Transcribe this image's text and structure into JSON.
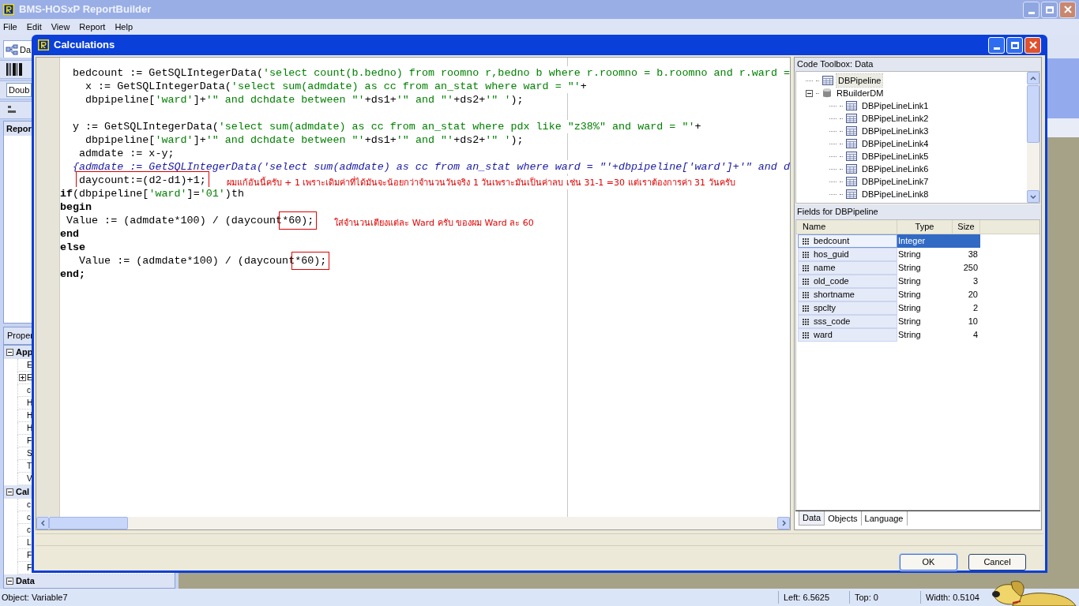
{
  "app": {
    "title": "BMS-HOSxP ReportBuilder",
    "menu": [
      "File",
      "Edit",
      "View",
      "Report",
      "Help"
    ]
  },
  "left_panel": {
    "tab": "Da",
    "toolbar_label": "Doub",
    "header": "Repor",
    "properties_tab": "Proper",
    "groups": [
      {
        "label": "App",
        "expanded": true,
        "rows": [
          {
            "label": "E",
            "kind": "plain"
          },
          {
            "label": "E",
            "kind": "expandable"
          },
          {
            "label": "c",
            "kind": "plain"
          },
          {
            "label": "H",
            "kind": "plain"
          },
          {
            "label": "H",
            "kind": "plain"
          },
          {
            "label": "H",
            "kind": "plain"
          },
          {
            "label": "F",
            "kind": "plain"
          },
          {
            "label": "S",
            "kind": "plain"
          },
          {
            "label": "T",
            "kind": "plain"
          },
          {
            "label": "V",
            "kind": "plain"
          }
        ]
      },
      {
        "label": "Cal",
        "expanded": true,
        "rows": [
          {
            "label": "c",
            "kind": "plain"
          },
          {
            "label": "c",
            "kind": "plain"
          },
          {
            "label": "c",
            "kind": "plain"
          },
          {
            "label": "L",
            "kind": "plain"
          },
          {
            "label": "F",
            "kind": "plain"
          },
          {
            "label": "F",
            "kind": "plain"
          }
        ]
      },
      {
        "label": "Data",
        "expanded": true
      }
    ]
  },
  "dialog": {
    "title": "Calculations",
    "code_lines": [
      {
        "kind": "code",
        "segments": [
          {
            "kind": "plain",
            "text": "  bedcount := GetSQLIntegerData("
          },
          {
            "kind": "string",
            "text": "'select count(b.bedno) from roomno r,bedno b where r.roomno = b.roomno and r.ward ="
          }
        ]
      },
      {
        "kind": "code",
        "segments": [
          {
            "kind": "plain",
            "text": "    x := GetSQLIntegerData("
          },
          {
            "kind": "string",
            "text": "'select sum(admdate) as cc from an_stat where ward = \"'"
          },
          {
            "kind": "plain",
            "text": "+"
          }
        ]
      },
      {
        "kind": "code",
        "segments": [
          {
            "kind": "plain",
            "text": "    dbpipeline["
          },
          {
            "kind": "string",
            "text": "'ward'"
          },
          {
            "kind": "plain",
            "text": "]+"
          },
          {
            "kind": "string",
            "text": "'\" and dchdate between \"'"
          },
          {
            "kind": "plain",
            "text": "+ds1+"
          },
          {
            "kind": "string",
            "text": "'\" and \"'"
          },
          {
            "kind": "plain",
            "text": "+ds2+"
          },
          {
            "kind": "string",
            "text": "'\" '"
          },
          {
            "kind": "plain",
            "text": ");"
          }
        ]
      },
      {
        "kind": "blank"
      },
      {
        "kind": "code",
        "segments": [
          {
            "kind": "plain",
            "text": "  y := GetSQLIntegerData("
          },
          {
            "kind": "string",
            "text": "'select sum(admdate) as cc from an_stat where pdx like \"z38%\" and ward = \"'"
          },
          {
            "kind": "plain",
            "text": "+"
          }
        ]
      },
      {
        "kind": "code",
        "segments": [
          {
            "kind": "plain",
            "text": "    dbpipeline["
          },
          {
            "kind": "string",
            "text": "'ward'"
          },
          {
            "kind": "plain",
            "text": "]+"
          },
          {
            "kind": "string",
            "text": "'\" and dchdate between \"'"
          },
          {
            "kind": "plain",
            "text": "+ds1+"
          },
          {
            "kind": "string",
            "text": "'\" and \"'"
          },
          {
            "kind": "plain",
            "text": "+ds2+"
          },
          {
            "kind": "string",
            "text": "'\" '"
          },
          {
            "kind": "plain",
            "text": ");"
          }
        ]
      },
      {
        "kind": "code",
        "segments": [
          {
            "kind": "plain",
            "text": "   admdate := x-y;"
          }
        ]
      },
      {
        "kind": "code",
        "segments": [
          {
            "kind": "comment",
            "text": "  {admdate := GetSQLIntegerData('select sum(admdate) as cc from an_stat where ward = \"'+dbpipeline['ward']+'\" and d"
          }
        ]
      },
      {
        "kind": "code",
        "segments": [
          {
            "kind": "plain",
            "text": "   daycount:=(d2-d1)+1;",
            "boxed": true
          }
        ],
        "note": "ผมแก้อันนี้ครับ + 1 เพราะเดิมค่าที่ได้มันจะน้อยกว่าจำนวนวันจริง 1 วันเพราะมันเป็นค่าลบ เช่น 31-1 =30  แต่เราต้องการค่า 31 วันครับ"
      },
      {
        "kind": "code",
        "segments": [
          {
            "kind": "keyword",
            "text": "if"
          },
          {
            "kind": "plain",
            "text": "(dbpipeline["
          },
          {
            "kind": "string",
            "text": "'ward'"
          },
          {
            "kind": "plain",
            "text": "]="
          },
          {
            "kind": "string",
            "text": "'01'"
          },
          {
            "kind": "plain",
            "text": ")th"
          }
        ]
      },
      {
        "kind": "code",
        "segments": [
          {
            "kind": "keyword",
            "text": "begin"
          }
        ]
      },
      {
        "kind": "code",
        "segments": [
          {
            "kind": "plain",
            "text": " Value := (admdate*100) / (daycount"
          },
          {
            "kind": "plain",
            "text": "*60);",
            "boxed": true
          }
        ],
        "note": "ใส่จำนวนเตียงแต่ละ Ward ครับ ของผม Ward ละ 60"
      },
      {
        "kind": "code",
        "segments": [
          {
            "kind": "keyword",
            "text": "end"
          }
        ]
      },
      {
        "kind": "code",
        "segments": [
          {
            "kind": "keyword",
            "text": "else"
          }
        ]
      },
      {
        "kind": "code",
        "segments": [
          {
            "kind": "plain",
            "text": "   Value := (admdate*100) / (daycount"
          },
          {
            "kind": "plain",
            "text": "*60);",
            "boxed": true
          }
        ]
      },
      {
        "kind": "code",
        "segments": [
          {
            "kind": "keyword",
            "text": "end;"
          }
        ]
      }
    ],
    "toolbox": {
      "title": "Code Toolbox: Data",
      "tree": [
        {
          "label": "DBPipeline",
          "kind": "table",
          "selected": true
        },
        {
          "label": "RBuilderDM",
          "kind": "database",
          "selected": false,
          "expanded": true,
          "children": [
            {
              "label": "DBPipeLineLink1",
              "kind": "table",
              "selected": false
            },
            {
              "label": "DBPipeLineLink2",
              "kind": "table",
              "selected": false
            },
            {
              "label": "DBPipeLineLink3",
              "kind": "table",
              "selected": false
            },
            {
              "label": "DBPipeLineLink4",
              "kind": "table",
              "selected": false
            },
            {
              "label": "DBPipeLineLink5",
              "kind": "table",
              "selected": false
            },
            {
              "label": "DBPipeLineLink6",
              "kind": "table",
              "selected": false
            },
            {
              "label": "DBPipeLineLink7",
              "kind": "table",
              "selected": false
            },
            {
              "label": "DBPipeLineLink8",
              "kind": "table",
              "selected": false
            }
          ]
        }
      ]
    },
    "fields": {
      "title": "Fields for DBPipeline",
      "columns": [
        "Name",
        "Type",
        "Size"
      ],
      "rows": [
        {
          "name": "bedcount",
          "type": "Integer",
          "selected": true
        },
        {
          "name": "hos_guid",
          "type": "String",
          "size": "38",
          "selected": false
        },
        {
          "name": "name",
          "type": "String",
          "size": "250",
          "selected": false
        },
        {
          "name": "old_code",
          "type": "String",
          "size": "3",
          "selected": false
        },
        {
          "name": "shortname",
          "type": "String",
          "size": "20",
          "selected": false
        },
        {
          "name": "spclty",
          "type": "String",
          "size": "2",
          "selected": false
        },
        {
          "name": "sss_code",
          "type": "String",
          "size": "10",
          "selected": false
        },
        {
          "name": "ward",
          "type": "String",
          "size": "4",
          "selected": false
        }
      ]
    },
    "tabs": [
      {
        "label": "Data",
        "selected": true
      },
      {
        "label": "Objects",
        "selected": false
      },
      {
        "label": "Language",
        "selected": false
      }
    ],
    "buttons": [
      {
        "label": "OK",
        "default": true
      },
      {
        "label": "Cancel",
        "default": false
      }
    ]
  },
  "status_bar": {
    "object": "Object: Variable7",
    "fields": [
      "Left: 6.5625",
      "Top: 0",
      "Width: 0.5104"
    ]
  }
}
